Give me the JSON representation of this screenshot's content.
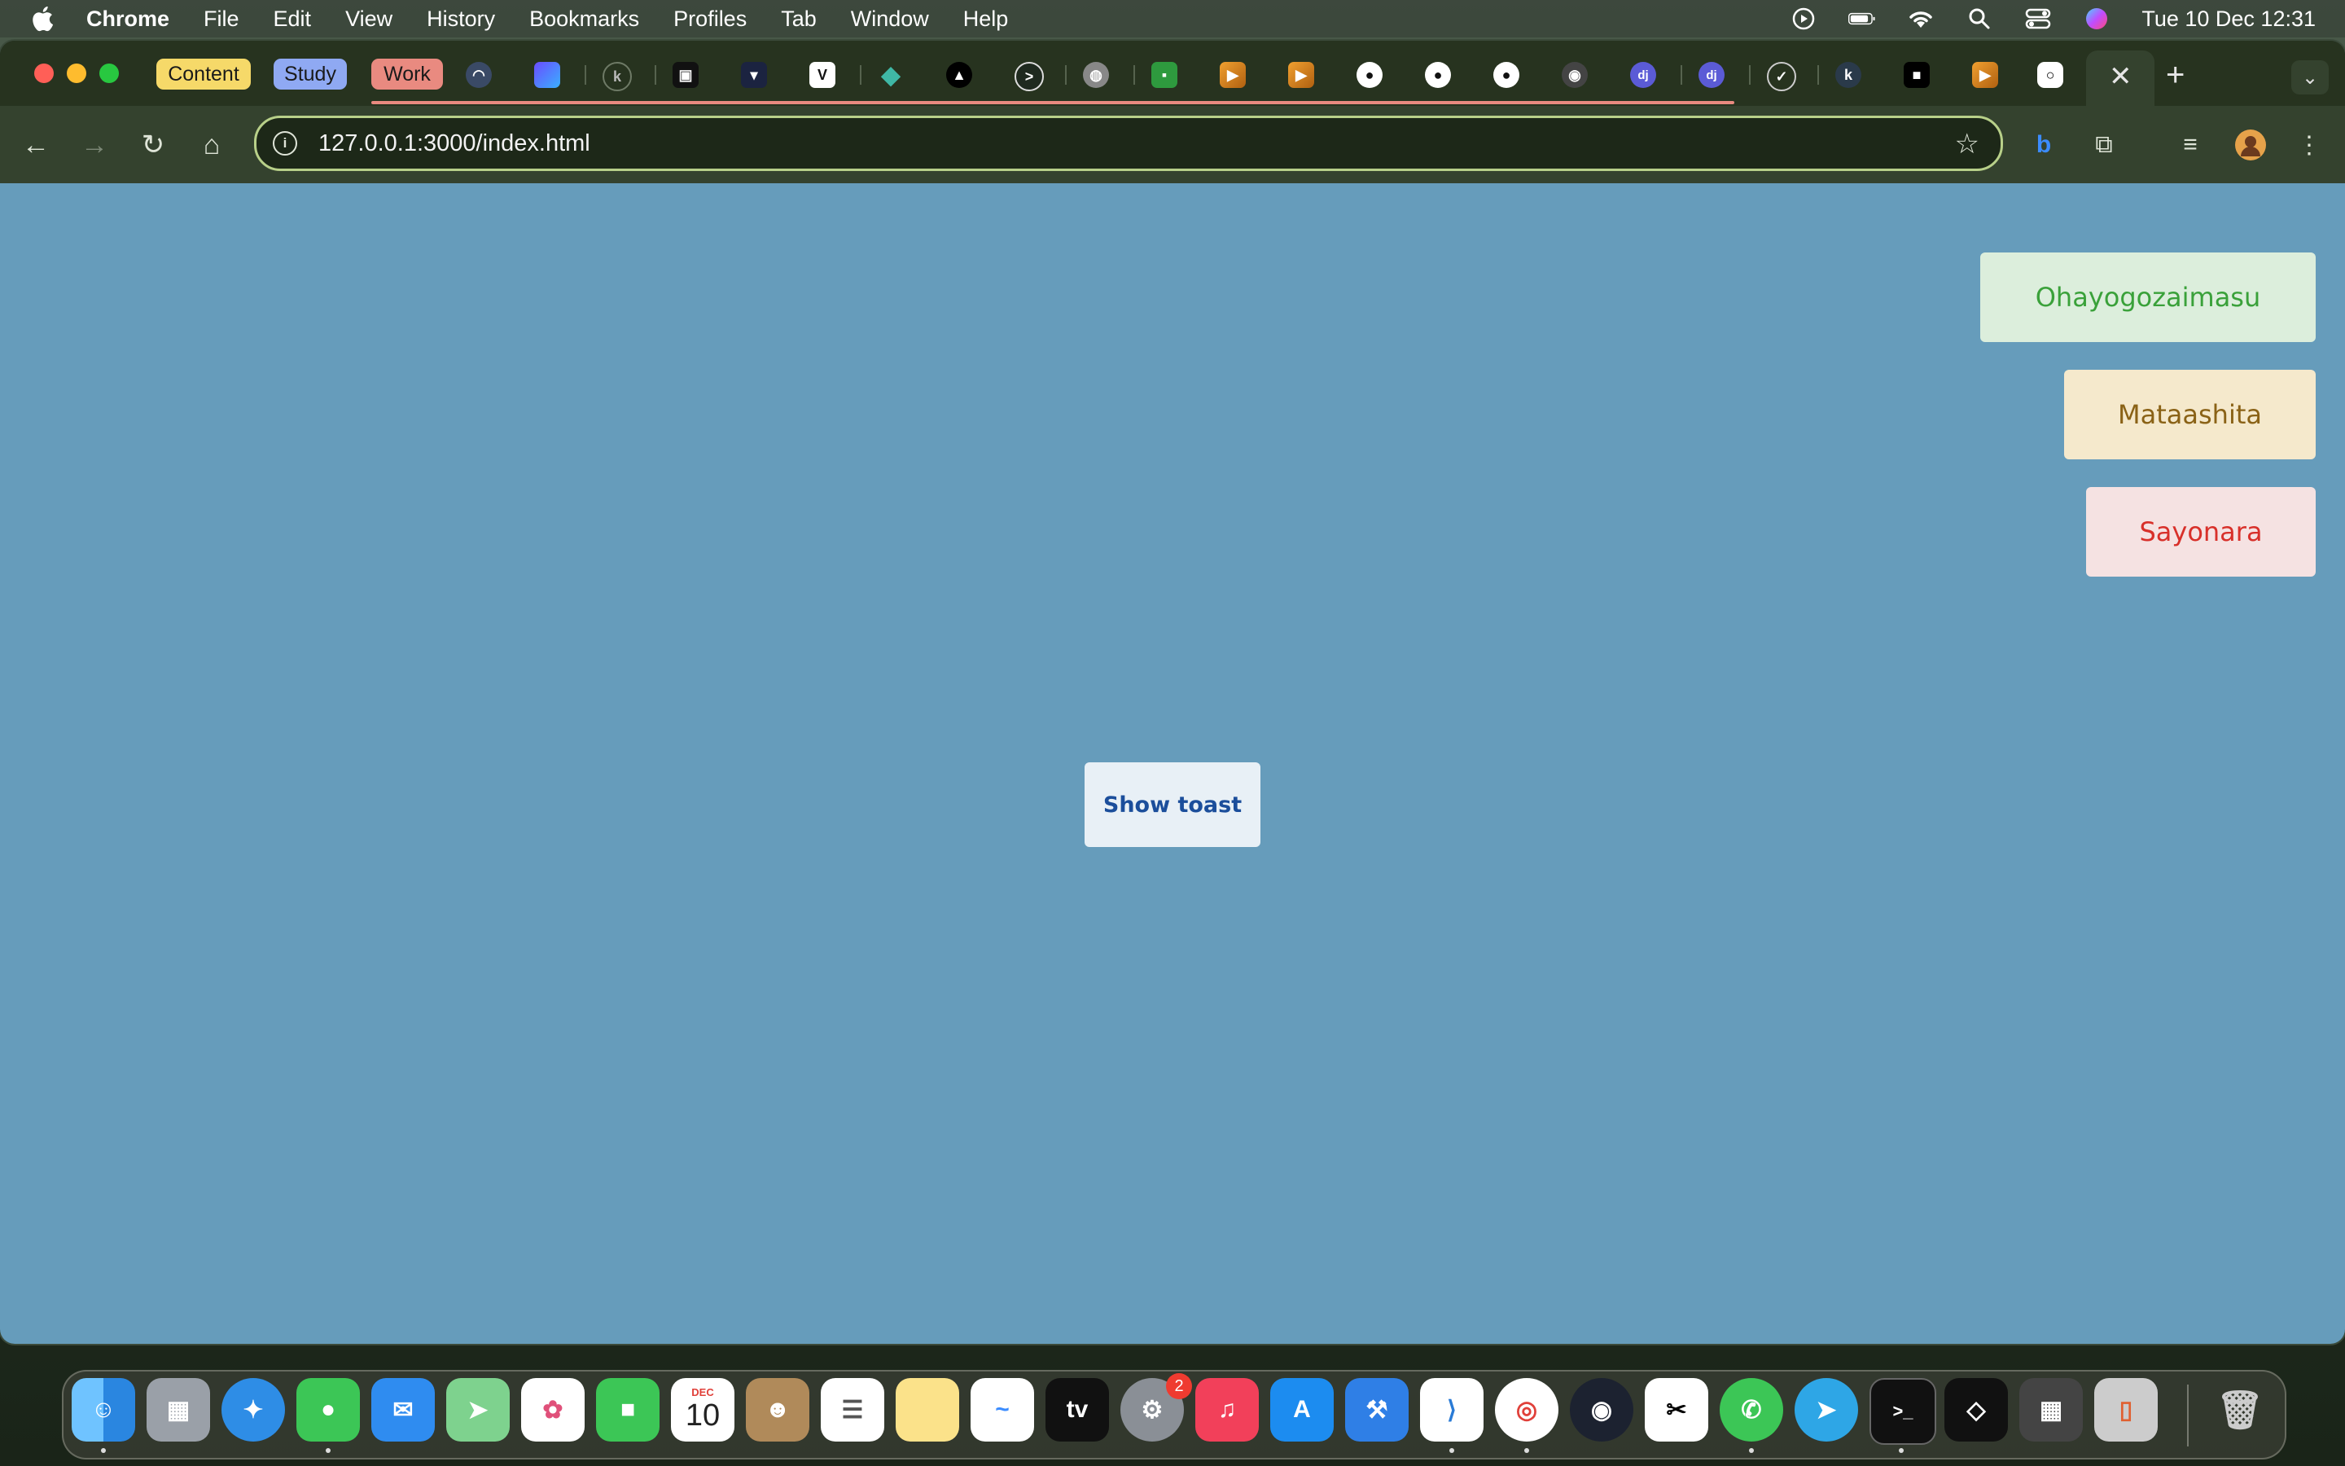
{
  "menubar": {
    "app_name": "Chrome",
    "items": [
      "File",
      "Edit",
      "View",
      "History",
      "Bookmarks",
      "Profiles",
      "Tab",
      "Window",
      "Help"
    ],
    "clock": "Tue 10 Dec  12:31"
  },
  "tab_groups": [
    {
      "label": "Content",
      "color": "#f6d969"
    },
    {
      "label": "Study",
      "color": "#8fa9f3"
    },
    {
      "label": "Work",
      "color": "#e98a80"
    }
  ],
  "browser": {
    "url": "127.0.0.1:3000/index.html",
    "close_tab": "✕",
    "new_tab": "+"
  },
  "page": {
    "button_label": "Show toast",
    "toasts": [
      {
        "text": "Ohayogozaimasu",
        "type": "success"
      },
      {
        "text": "Mataashita",
        "type": "warning"
      },
      {
        "text": "Sayonara",
        "type": "error"
      }
    ],
    "background_color": "#669cbb"
  },
  "dock": {
    "system_settings_badge": "2",
    "calendar_month": "DEC",
    "calendar_day": "10"
  }
}
